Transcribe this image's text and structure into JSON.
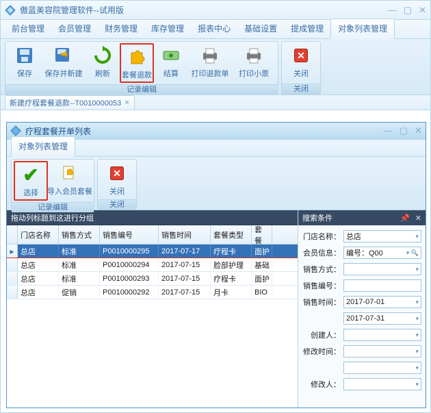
{
  "window": {
    "title": "傲蓝美容院管理软件--试用版"
  },
  "main_menu": [
    "前台管理",
    "会员管理",
    "财务管理",
    "库存管理",
    "报表中心",
    "基础设置",
    "提成管理",
    "对象列表管理"
  ],
  "main_menu_active_index": 7,
  "ribbon": {
    "groups": [
      {
        "label": "记录编辑",
        "buttons": [
          {
            "name": "save-button",
            "label": "保存",
            "icon": "disk"
          },
          {
            "name": "save-new-button",
            "label": "保存并新建",
            "icon": "disk-arrow",
            "wide": true
          },
          {
            "name": "refresh-button",
            "label": "刷新",
            "icon": "refresh"
          },
          {
            "name": "package-refund-button",
            "label": "套餐退款",
            "icon": "puzzle",
            "highlight": true
          },
          {
            "name": "settle-button",
            "label": "结算",
            "icon": "cash"
          },
          {
            "name": "print-refund-button",
            "label": "打印退款单",
            "icon": "printer",
            "wide": true
          },
          {
            "name": "print-receipt-button",
            "label": "打印小票",
            "icon": "printer",
            "wide": true
          }
        ]
      },
      {
        "label": "关闭",
        "buttons": [
          {
            "name": "close-button",
            "label": "关闭",
            "icon": "close-x"
          }
        ]
      }
    ]
  },
  "doc_tab": {
    "label": "新建疗程套餐退款--T0010000053"
  },
  "inner": {
    "title": "疗程套餐开单列表",
    "menu_tab": "对象列表管理",
    "ribbon_groups": [
      {
        "label": "记录编辑",
        "buttons": [
          {
            "name": "select-button",
            "label": "选择",
            "icon": "check",
            "highlight": true
          },
          {
            "name": "import-member-package-button",
            "label": "导入会员套餐",
            "icon": "puzzle-doc",
            "wide": true
          }
        ]
      },
      {
        "label": "关闭",
        "buttons": [
          {
            "name": "inner-close-button",
            "label": "关闭",
            "icon": "close-x"
          }
        ]
      }
    ]
  },
  "grid": {
    "group_bar": "拖动列标题到这进行分组",
    "columns": [
      "门店名称",
      "销售方式",
      "销售编号",
      "销售时间",
      "套餐类型",
      "套餐"
    ],
    "rows": [
      {
        "store": "总店",
        "method": "标准",
        "sn": "P0010000295",
        "time": "2017-07-17",
        "type": "疗程卡",
        "pkg": "面护"
      },
      {
        "store": "总店",
        "method": "标准",
        "sn": "P0010000294",
        "time": "2017-07-15",
        "type": "脸部护理",
        "pkg": "基础"
      },
      {
        "store": "总店",
        "method": "标准",
        "sn": "P0010000293",
        "time": "2017-07-15",
        "type": "疗程卡",
        "pkg": "面护"
      },
      {
        "store": "总店",
        "method": "促销",
        "sn": "P0010000292",
        "time": "2017-07-15",
        "type": "月卡",
        "pkg": "BIO"
      }
    ],
    "selected_index": 0
  },
  "search": {
    "header": "搜索条件",
    "fields": {
      "store_label": "门店名称：",
      "store_value": "总店",
      "member_label": "会员信息：",
      "member_value": "编号：Q00",
      "method_label": "销售方式：",
      "method_value": "",
      "sn_label": "销售编号：",
      "sn_value": "",
      "time_label": "销售时间：",
      "time_from": "2017-07-01",
      "time_to": "2017-07-31",
      "creator_label": "创建人：",
      "creator_value": "",
      "mtime_label": "修改时间：",
      "mtime_value": "",
      "modifier_label": "修改人：",
      "modifier_value": ""
    }
  }
}
